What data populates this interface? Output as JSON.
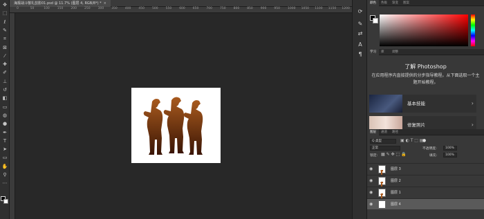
{
  "document": {
    "tab_title": "海报战斗敬礼剪影01.psd @ 11.7% (图层 4, RGB/8*) *",
    "close_glyph": "×"
  },
  "ruler": {
    "ticks": [
      "0",
      "50",
      "100",
      "150",
      "200",
      "250",
      "300",
      "350",
      "400",
      "450",
      "500",
      "550",
      "600",
      "650",
      "700",
      "750",
      "800",
      "850",
      "900",
      "950",
      "1000",
      "1050",
      "1100",
      "1150",
      "1200"
    ]
  },
  "toolbar": {
    "tools": [
      {
        "name": "move-tool",
        "glyph": "✥"
      },
      {
        "name": "marquee-tool",
        "glyph": "⬚"
      },
      {
        "name": "lasso-tool",
        "glyph": "ℓ"
      },
      {
        "name": "quick-select-tool",
        "glyph": "✎"
      },
      {
        "name": "crop-tool",
        "glyph": "⌗"
      },
      {
        "name": "frame-tool",
        "glyph": "⊠"
      },
      {
        "name": "eyedropper-tool",
        "glyph": "⁄"
      },
      {
        "name": "healing-tool",
        "glyph": "✚"
      },
      {
        "name": "brush-tool",
        "glyph": "✐"
      },
      {
        "name": "stamp-tool",
        "glyph": "⊥"
      },
      {
        "name": "history-brush-tool",
        "glyph": "↺"
      },
      {
        "name": "eraser-tool",
        "glyph": "◧"
      },
      {
        "name": "gradient-tool",
        "glyph": "▭"
      },
      {
        "name": "blur-tool",
        "glyph": "◍"
      },
      {
        "name": "dodge-tool",
        "glyph": "●"
      },
      {
        "name": "pen-tool",
        "glyph": "✒"
      },
      {
        "name": "type-tool",
        "glyph": "T"
      },
      {
        "name": "path-select-tool",
        "glyph": "➤"
      },
      {
        "name": "shape-tool",
        "glyph": "▭"
      },
      {
        "name": "hand-tool",
        "glyph": "✋"
      },
      {
        "name": "zoom-tool",
        "glyph": "⚲"
      },
      {
        "name": "more-tools",
        "glyph": "⋯"
      }
    ]
  },
  "panels": {
    "color_tabs": [
      "颜色",
      "色板",
      "渐变",
      "图案"
    ],
    "learn_tabs": [
      "学习",
      "库",
      "调整"
    ],
    "learn": {
      "title": "了解 Photoshop",
      "description": "在应用程序内直接提供的分步指导教程。从下面选取一个主题开始教程。",
      "cards": [
        {
          "label": "基本技能",
          "chevron": "›"
        },
        {
          "label": "修复照片",
          "chevron": "›"
        }
      ]
    },
    "layers_tabs": [
      "图层",
      "通道",
      "路径"
    ],
    "layers": {
      "filter_kind": "Q 类型",
      "blend_mode": "正常",
      "opacity_label": "不透明度:",
      "opacity_value": "100%",
      "lock_label": "锁定:",
      "fill_label": "填充:",
      "fill_value": "100%",
      "items": [
        {
          "name": "图层 3",
          "selected": false
        },
        {
          "name": "图层 2",
          "selected": false
        },
        {
          "name": "图层 1",
          "selected": false
        },
        {
          "name": "图层 4",
          "selected": true
        }
      ]
    }
  },
  "colors": {
    "accent_gradient_top": "#a85a1e",
    "accent_gradient_bottom": "#3a1505"
  }
}
